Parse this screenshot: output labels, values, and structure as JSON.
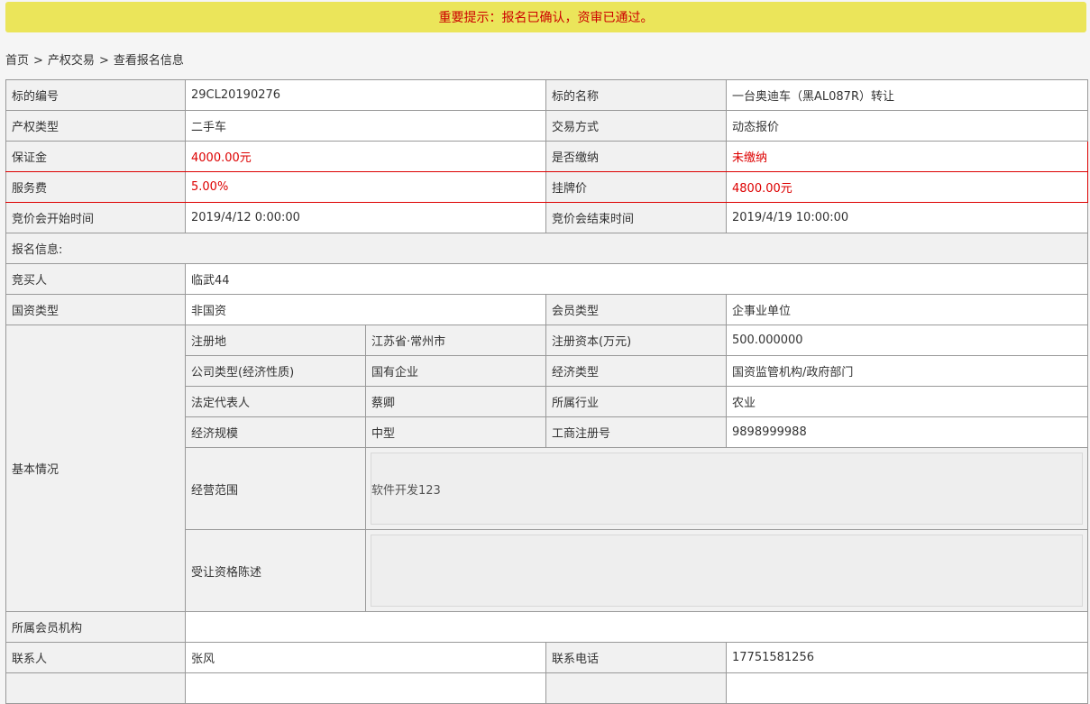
{
  "notice": "重要提示：报名已确认，资审已通过。",
  "breadcrumb": {
    "home": "首页",
    "sep": ">",
    "section": "产权交易",
    "current": "查看报名信息"
  },
  "rows": {
    "code_label": "标的编号",
    "code": "29CL20190276",
    "name_label": "标的名称",
    "name": "一台奥迪车（黑AL087R）转让",
    "type_label": "产权类型",
    "type": "二手车",
    "method_label": "交易方式",
    "method": "动态报价",
    "deposit_label": "保证金",
    "deposit": "4000.00元",
    "paid_label": "是否缴纳",
    "paid": "未缴纳",
    "fee_label": "服务费",
    "fee": "5.00%",
    "price_label": "挂牌价",
    "price": "4800.00元",
    "start_label": "竞价会开始时间",
    "start": "2019/4/12 0:00:00",
    "end_label": "竞价会结束时间",
    "end": "2019/4/19 10:00:00",
    "signup_label": "报名信息:",
    "buyer_label": "竞买人",
    "buyer": "临武44",
    "stateasset_label": "国资类型",
    "stateasset": "非国资",
    "member_type_label": "会员类型",
    "member_type": "企事业单位",
    "basic_label": "基本情况",
    "reg_place_label": "注册地",
    "reg_place": "江苏省·常州市",
    "capital_label": "注册资本(万元)",
    "capital": "500.000000",
    "company_type_label": "公司类型(经济性质)",
    "company_type": "国有企业",
    "econ_type_label": "经济类型",
    "econ_type": "国资监管机构/政府部门",
    "legal_rep_label": "法定代表人",
    "legal_rep": "蔡卿",
    "industry_label": "所属行业",
    "industry": "农业",
    "scale_label": "经济规模",
    "scale": "中型",
    "biz_reg_label": "工商注册号",
    "biz_reg": "9898999988",
    "scope_label": "经营范围",
    "scope": "软件开发123",
    "qualification_label": "受让资格陈述",
    "qualification": "",
    "org_label": "所属会员机构",
    "org": "",
    "contact_label": "联系人",
    "contact": "张风",
    "phone_label": "联系电话",
    "phone": "17751581256"
  }
}
